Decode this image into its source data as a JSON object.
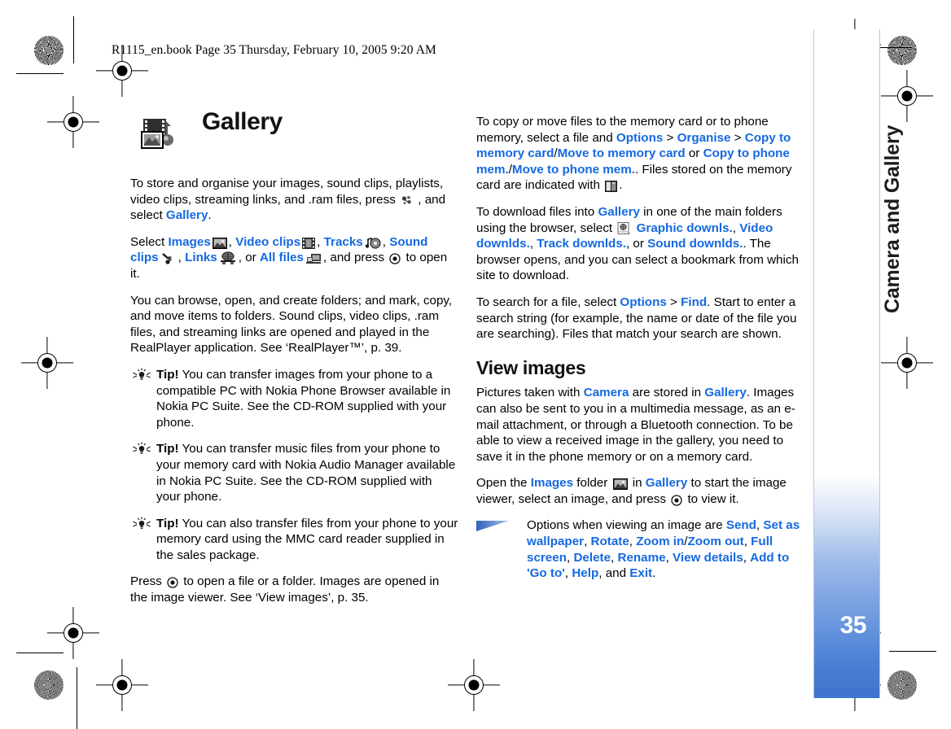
{
  "header": {
    "file_line": "R1115_en.book  Page 35  Thursday, February 10, 2005  9:20 AM"
  },
  "sidebar": {
    "chapter_title": "Camera and Gallery",
    "page_number": "35",
    "accent_color": "#3d73cd"
  },
  "colors": {
    "link_blue": "#1569e0",
    "body_black": "#000000"
  },
  "left_column": {
    "heading": "Gallery",
    "heading_icon": "gallery-icon",
    "p1": {
      "a": "To store and organise your images, sound clips, playlists, video clips, streaming links, and .ram files, press ",
      "icon": "menu-key-icon",
      "b": " , and select ",
      "link": "Gallery",
      "c": "."
    },
    "p2": {
      "a": "Select ",
      "link1": "Images",
      "icon1": "images-folder-icon",
      "sep1": ", ",
      "link2": "Video clips",
      "icon2": "video-clips-icon",
      "sep2": ", ",
      "link3": "Tracks",
      "icon3": "tracks-icon",
      "sep3": ", ",
      "link4": "Sound clips",
      "icon4": "sound-clips-icon",
      "sep4": ", ",
      "link5": "Links",
      "icon5": "links-icon",
      "sep5": ", or ",
      "link6": "All files",
      "icon6": "all-files-icon",
      "tail_a": ", and press ",
      "icon7": "scroll-key-icon",
      "tail_b": " to open it."
    },
    "p3": "You can browse, open, and create folders; and mark, copy, and move items to folders. Sound clips, video clips, .ram files, and streaming links are opened and played in the RealPlayer application. See ‘RealPlayer™’, p. 39.",
    "tips": [
      {
        "label": "Tip!",
        "text": " You can transfer images from your phone to a compatible PC with Nokia Phone Browser available in Nokia PC Suite. See the CD-ROM supplied with your phone."
      },
      {
        "label": "Tip!",
        "text": " You can transfer music files from your phone to your memory card with Nokia Audio Manager available in Nokia PC Suite. See the CD-ROM supplied with your phone."
      },
      {
        "label": "Tip!",
        "text": " You can also transfer files from your phone to your memory card using the MMC card reader supplied in the sales package."
      }
    ],
    "p4": {
      "a": "Press ",
      "icon": "scroll-key-icon",
      "b": " to open a file or a folder. Images are opened in the image viewer. See ‘View images’, p. 35."
    }
  },
  "right_column": {
    "p1": {
      "a": "To copy or move files to the memory card or to phone memory, select a file and ",
      "l1": "Options",
      "gt1": " > ",
      "l2": "Organise",
      "gt2": " > ",
      "l3": "Copy to memory card",
      "slash1": "/",
      "l4": "Move to memory card",
      "mid": " or ",
      "l5": "Copy to phone mem.",
      "slash2": "/",
      "l6": "Move to phone mem.",
      "b": ". Files stored on the memory card are indicated with ",
      "icon": "memory-card-icon",
      "c": "."
    },
    "p2": {
      "a": "To download files into ",
      "l1": "Gallery",
      "b": " in one of the main folders using the browser, select ",
      "icon": "browser-downloads-icon",
      "l2": "Graphic downls.",
      "s1": ", ",
      "l3": "Video downlds.",
      "s2": ", ",
      "l4": "Track downlds.",
      "s3": ", or ",
      "l5": "Sound downlds.",
      "c": ". The browser opens, and you can select a bookmark from which site to download."
    },
    "p3": {
      "a": "To search for a file, select ",
      "l1": "Options",
      "gt": " > ",
      "l2": "Find",
      "b": ". Start to enter a search string (for example, the name or date of the file you are searching). Files that match your search are shown."
    },
    "heading": "View images",
    "p4": {
      "a": "Pictures taken with ",
      "l1": "Camera",
      "b": " are stored in ",
      "l2": "Gallery",
      "c": ". Images can also be sent to you in a multimedia message, as an e-mail attachment, or through a Bluetooth connection. To be able to view a received image in the gallery, you need to save it in the phone memory or on a memory card."
    },
    "p5": {
      "a": "Open the ",
      "l1": "Images",
      "b": " folder ",
      "icon1": "images-folder-icon",
      "c": " in ",
      "l2": "Gallery",
      "d": " to start the image viewer, select an image, and press ",
      "icon2": "scroll-key-icon",
      "e": " to view it."
    },
    "note": {
      "icon": "note-arrow-icon",
      "a": "Options when viewing an image are ",
      "items": [
        "Send",
        "Set as wallpaper",
        "Rotate",
        "Zoom in",
        "Zoom out",
        "Full screen",
        "Delete",
        "Rename",
        "View details",
        "Add to 'Go to'",
        "Help",
        "Exit"
      ],
      "tail": "."
    }
  }
}
